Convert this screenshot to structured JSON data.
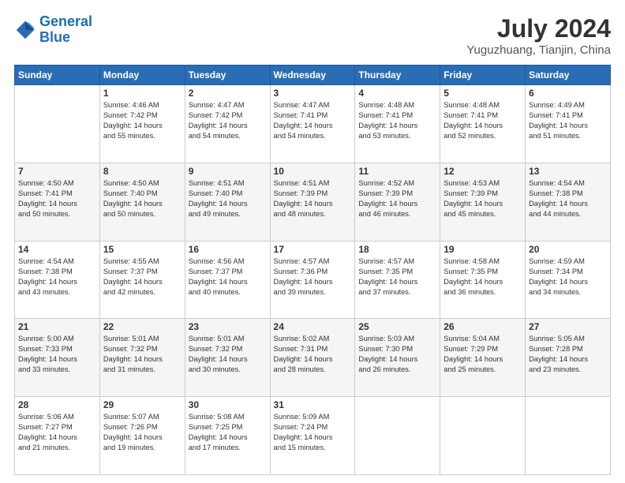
{
  "header": {
    "logo_line1": "General",
    "logo_line2": "Blue",
    "month_year": "July 2024",
    "location": "Yuguzhuang, Tianjin, China"
  },
  "weekdays": [
    "Sunday",
    "Monday",
    "Tuesday",
    "Wednesday",
    "Thursday",
    "Friday",
    "Saturday"
  ],
  "weeks": [
    [
      {
        "day": "",
        "content": ""
      },
      {
        "day": "1",
        "content": "Sunrise: 4:46 AM\nSunset: 7:42 PM\nDaylight: 14 hours\nand 55 minutes."
      },
      {
        "day": "2",
        "content": "Sunrise: 4:47 AM\nSunset: 7:42 PM\nDaylight: 14 hours\nand 54 minutes."
      },
      {
        "day": "3",
        "content": "Sunrise: 4:47 AM\nSunset: 7:41 PM\nDaylight: 14 hours\nand 54 minutes."
      },
      {
        "day": "4",
        "content": "Sunrise: 4:48 AM\nSunset: 7:41 PM\nDaylight: 14 hours\nand 53 minutes."
      },
      {
        "day": "5",
        "content": "Sunrise: 4:48 AM\nSunset: 7:41 PM\nDaylight: 14 hours\nand 52 minutes."
      },
      {
        "day": "6",
        "content": "Sunrise: 4:49 AM\nSunset: 7:41 PM\nDaylight: 14 hours\nand 51 minutes."
      }
    ],
    [
      {
        "day": "7",
        "content": "Sunrise: 4:50 AM\nSunset: 7:41 PM\nDaylight: 14 hours\nand 50 minutes."
      },
      {
        "day": "8",
        "content": "Sunrise: 4:50 AM\nSunset: 7:40 PM\nDaylight: 14 hours\nand 50 minutes."
      },
      {
        "day": "9",
        "content": "Sunrise: 4:51 AM\nSunset: 7:40 PM\nDaylight: 14 hours\nand 49 minutes."
      },
      {
        "day": "10",
        "content": "Sunrise: 4:51 AM\nSunset: 7:39 PM\nDaylight: 14 hours\nand 48 minutes."
      },
      {
        "day": "11",
        "content": "Sunrise: 4:52 AM\nSunset: 7:39 PM\nDaylight: 14 hours\nand 46 minutes."
      },
      {
        "day": "12",
        "content": "Sunrise: 4:53 AM\nSunset: 7:39 PM\nDaylight: 14 hours\nand 45 minutes."
      },
      {
        "day": "13",
        "content": "Sunrise: 4:54 AM\nSunset: 7:38 PM\nDaylight: 14 hours\nand 44 minutes."
      }
    ],
    [
      {
        "day": "14",
        "content": "Sunrise: 4:54 AM\nSunset: 7:38 PM\nDaylight: 14 hours\nand 43 minutes."
      },
      {
        "day": "15",
        "content": "Sunrise: 4:55 AM\nSunset: 7:37 PM\nDaylight: 14 hours\nand 42 minutes."
      },
      {
        "day": "16",
        "content": "Sunrise: 4:56 AM\nSunset: 7:37 PM\nDaylight: 14 hours\nand 40 minutes."
      },
      {
        "day": "17",
        "content": "Sunrise: 4:57 AM\nSunset: 7:36 PM\nDaylight: 14 hours\nand 39 minutes."
      },
      {
        "day": "18",
        "content": "Sunrise: 4:57 AM\nSunset: 7:35 PM\nDaylight: 14 hours\nand 37 minutes."
      },
      {
        "day": "19",
        "content": "Sunrise: 4:58 AM\nSunset: 7:35 PM\nDaylight: 14 hours\nand 36 minutes."
      },
      {
        "day": "20",
        "content": "Sunrise: 4:59 AM\nSunset: 7:34 PM\nDaylight: 14 hours\nand 34 minutes."
      }
    ],
    [
      {
        "day": "21",
        "content": "Sunrise: 5:00 AM\nSunset: 7:33 PM\nDaylight: 14 hours\nand 33 minutes."
      },
      {
        "day": "22",
        "content": "Sunrise: 5:01 AM\nSunset: 7:32 PM\nDaylight: 14 hours\nand 31 minutes."
      },
      {
        "day": "23",
        "content": "Sunrise: 5:01 AM\nSunset: 7:32 PM\nDaylight: 14 hours\nand 30 minutes."
      },
      {
        "day": "24",
        "content": "Sunrise: 5:02 AM\nSunset: 7:31 PM\nDaylight: 14 hours\nand 28 minutes."
      },
      {
        "day": "25",
        "content": "Sunrise: 5:03 AM\nSunset: 7:30 PM\nDaylight: 14 hours\nand 26 minutes."
      },
      {
        "day": "26",
        "content": "Sunrise: 5:04 AM\nSunset: 7:29 PM\nDaylight: 14 hours\nand 25 minutes."
      },
      {
        "day": "27",
        "content": "Sunrise: 5:05 AM\nSunset: 7:28 PM\nDaylight: 14 hours\nand 23 minutes."
      }
    ],
    [
      {
        "day": "28",
        "content": "Sunrise: 5:06 AM\nSunset: 7:27 PM\nDaylight: 14 hours\nand 21 minutes."
      },
      {
        "day": "29",
        "content": "Sunrise: 5:07 AM\nSunset: 7:26 PM\nDaylight: 14 hours\nand 19 minutes."
      },
      {
        "day": "30",
        "content": "Sunrise: 5:08 AM\nSunset: 7:25 PM\nDaylight: 14 hours\nand 17 minutes."
      },
      {
        "day": "31",
        "content": "Sunrise: 5:09 AM\nSunset: 7:24 PM\nDaylight: 14 hours\nand 15 minutes."
      },
      {
        "day": "",
        "content": ""
      },
      {
        "day": "",
        "content": ""
      },
      {
        "day": "",
        "content": ""
      }
    ]
  ]
}
